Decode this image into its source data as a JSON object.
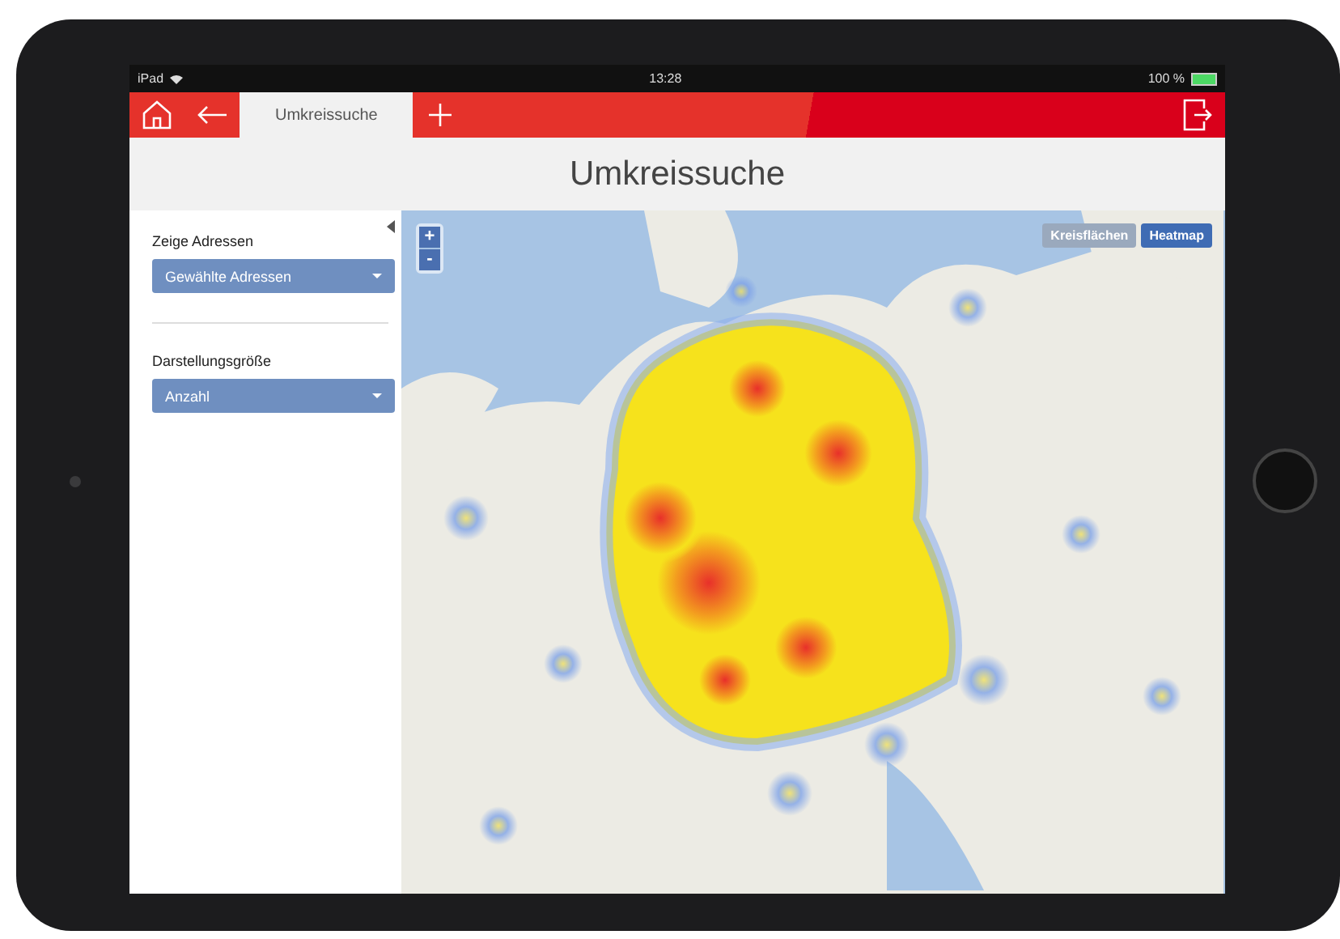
{
  "status_bar": {
    "device": "iPad",
    "time": "13:28",
    "battery": "100 %"
  },
  "toolbar": {
    "tabs": [
      {
        "label": "Umkreissuche",
        "selected": true
      }
    ]
  },
  "page_title": "Umkreissuche",
  "sidebar": {
    "fields": [
      {
        "label": "Zeige Adressen",
        "value": "Gewählte Adressen"
      },
      {
        "label": "Darstellungsgröße",
        "value": "Anzahl"
      }
    ]
  },
  "map": {
    "zoom_controls": [
      "+",
      "-"
    ],
    "layers": [
      {
        "label": "Kreisflächen",
        "selected": false
      },
      {
        "label": "Heatmap",
        "selected": true
      }
    ]
  }
}
